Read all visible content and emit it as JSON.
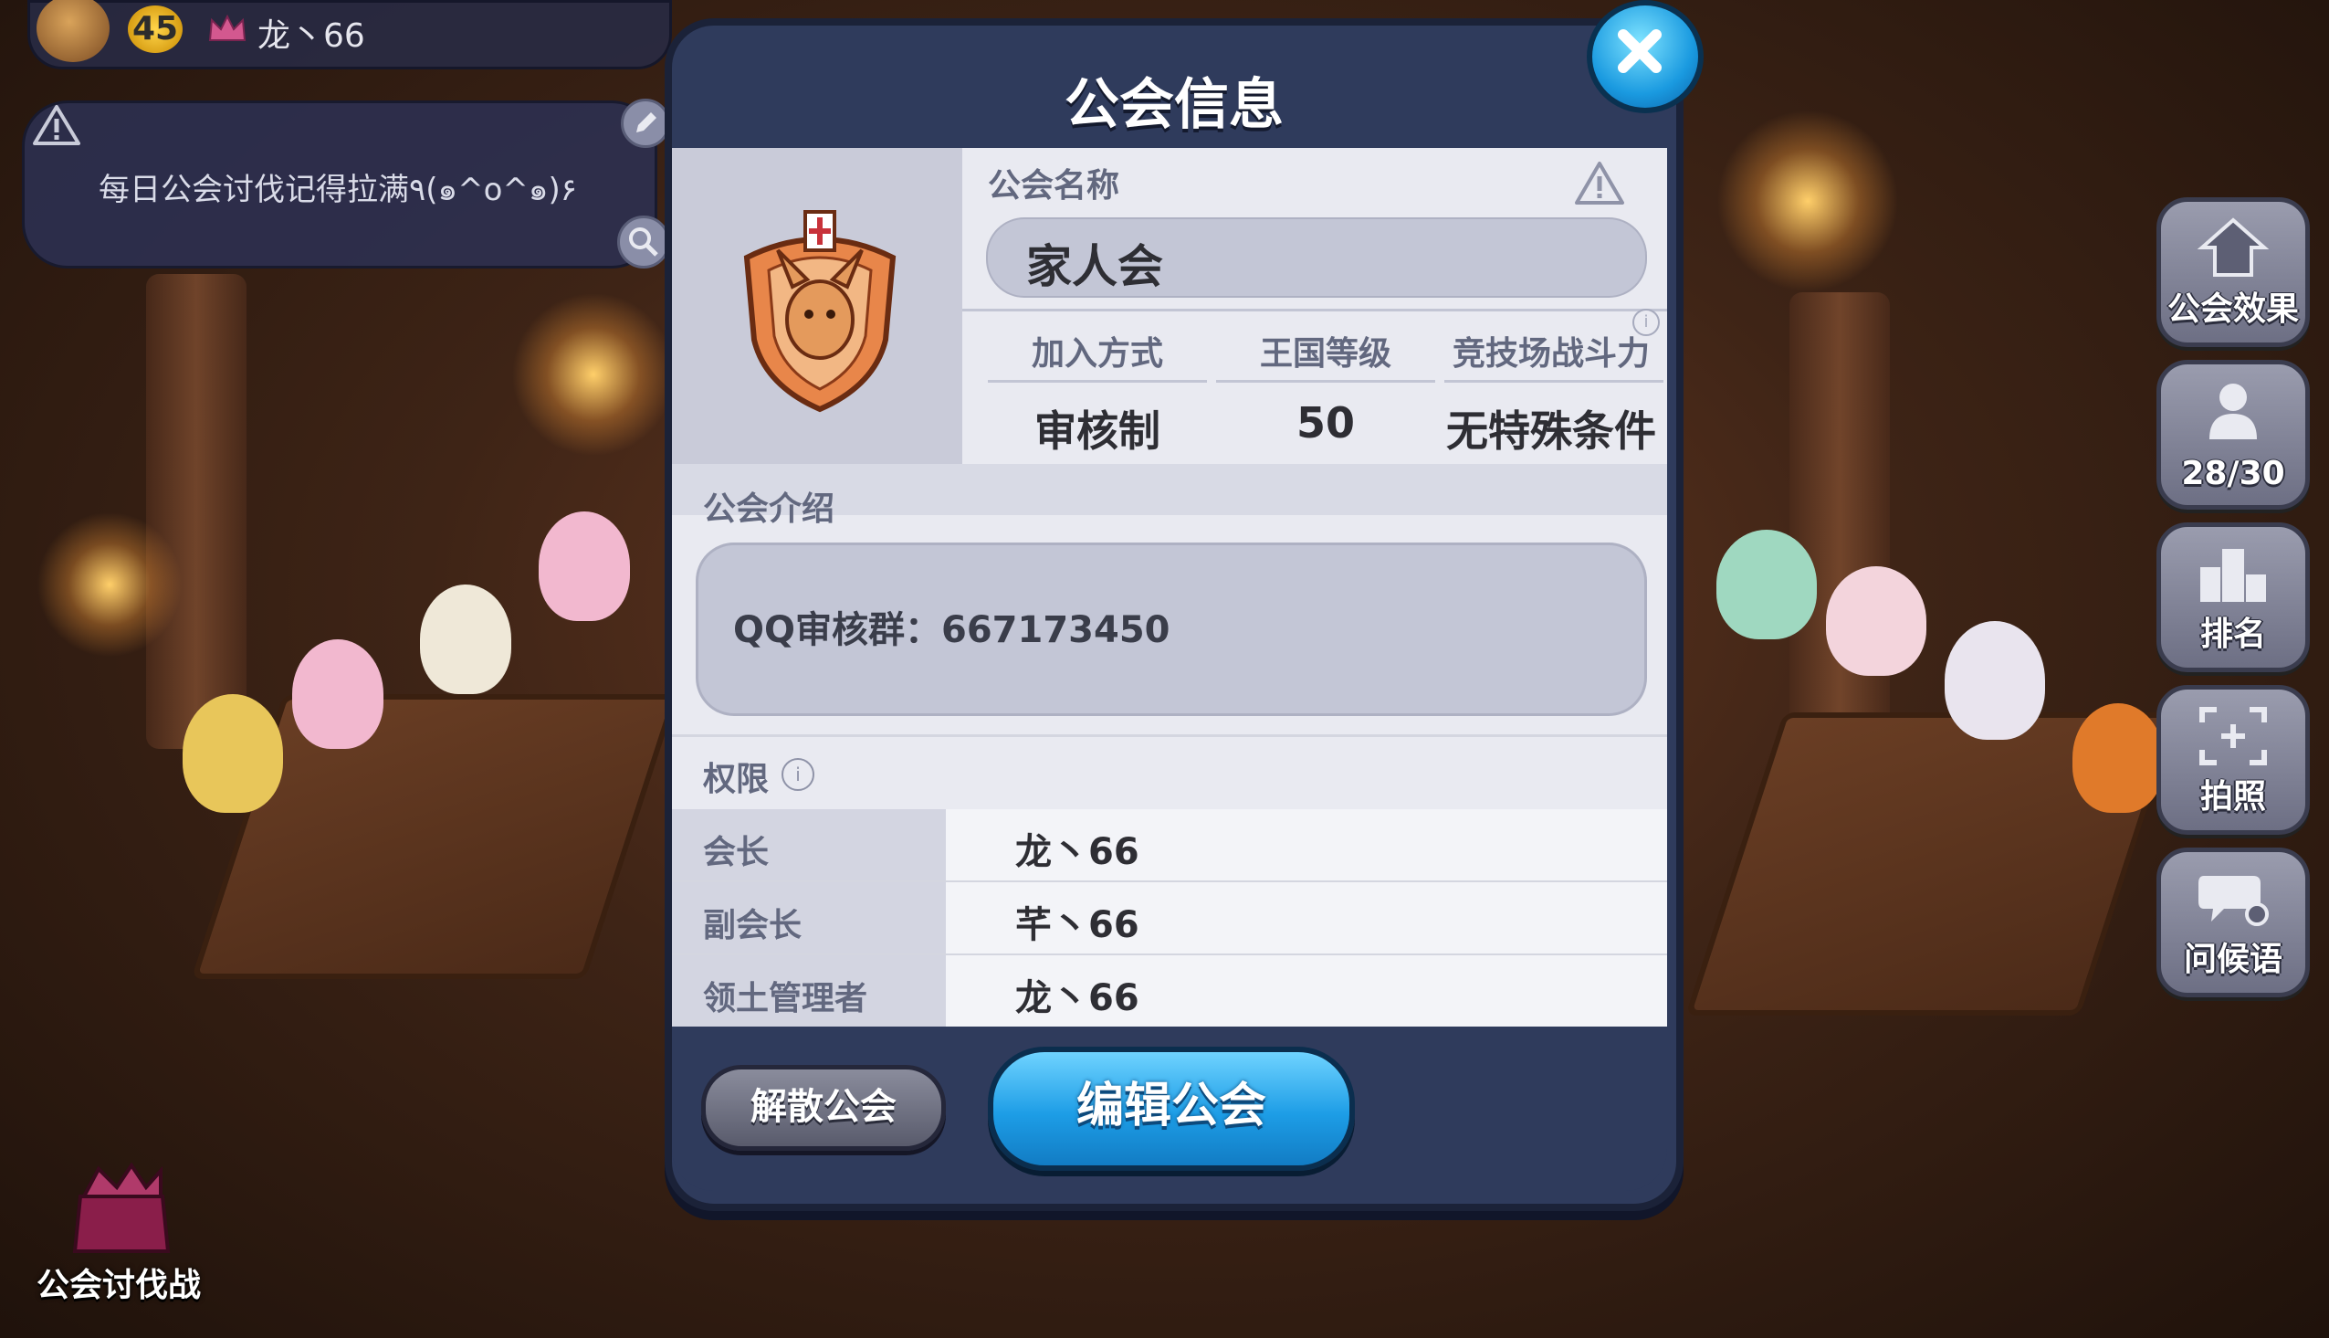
{
  "player": {
    "level": "45",
    "name": "龙丶66"
  },
  "notice": {
    "text": "每日公会讨伐记得拉满٩(๑^o^๑)۶"
  },
  "raid": {
    "label": "公会讨伐战"
  },
  "side_buttons": {
    "effect": "公会效果",
    "members": "28/30",
    "ranking": "排名",
    "photo": "拍照",
    "greeting": "问候语"
  },
  "dialog": {
    "title": "公会信息",
    "name_label": "公会名称",
    "guild_name": "家人会",
    "stats": [
      {
        "label": "加入方式",
        "value": "审核制"
      },
      {
        "label": "王国等级",
        "value": "50"
      },
      {
        "label": "竞技场战斗力",
        "value": "无特殊条件"
      }
    ],
    "intro_label": "公会介绍",
    "intro_text": "QQ审核群：667173450",
    "permissions_label": "权限",
    "roles": [
      {
        "role": "会长",
        "holder": "龙丶66"
      },
      {
        "role": "副会长",
        "holder": "芊丶66"
      },
      {
        "role": "领土管理者",
        "holder": "龙丶66"
      }
    ],
    "disband_label": "解散公会",
    "edit_label": "编辑公会"
  },
  "colors": {
    "dialog_frame": "#2f3b5c",
    "edit_button": "#1d9de6",
    "close_button": "#1a9ae0"
  }
}
